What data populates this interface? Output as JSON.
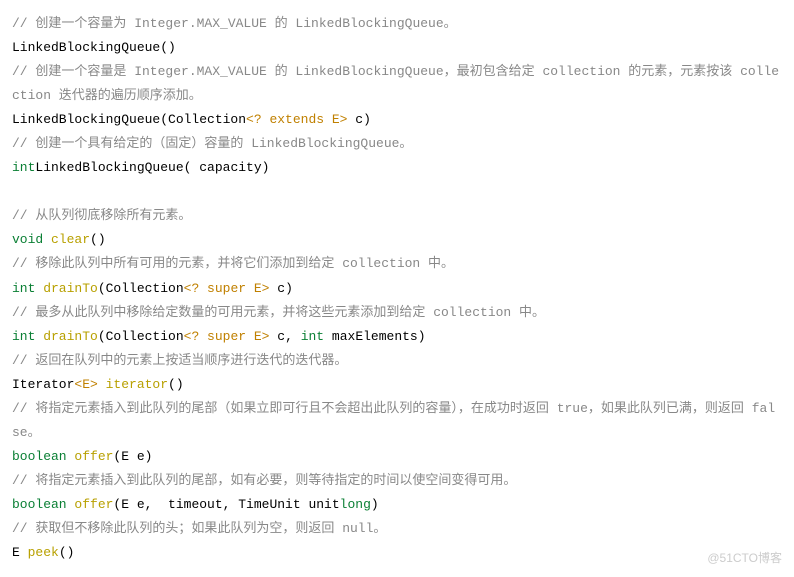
{
  "lines": [
    {
      "t": "comment",
      "v": "// 创建一个容量为 Integer.MAX_VALUE 的 LinkedBlockingQueue。"
    },
    {
      "t": "sig",
      "pre": "LinkedBlockingQueue(",
      "args": "",
      "post": ")"
    },
    {
      "t": "comment",
      "v": "// 创建一个容量是 Integer.MAX_VALUE 的 LinkedBlockingQueue，最初包含给定 collection 的元素，元素按该 collection 迭代器的遍历顺序添加。"
    },
    {
      "t": "sig",
      "pre": "LinkedBlockingQueue(Collection",
      "gen": "<? extends E>",
      "args": " c",
      "post": ")"
    },
    {
      "t": "comment",
      "v": "// 创建一个具有给定的（固定）容量的 LinkedBlockingQueue。"
    },
    {
      "t": "sig",
      "pre": "LinkedBlockingQueue(",
      "kw": "int",
      "args": " capacity",
      "post": ")"
    },
    {
      "t": "blank"
    },
    {
      "t": "comment",
      "v": "// 从队列彻底移除所有元素。"
    },
    {
      "t": "sig",
      "kw": "void",
      "name": " clear",
      "pre": "(",
      "args": "",
      "post": ")"
    },
    {
      "t": "comment",
      "v": "// 移除此队列中所有可用的元素，并将它们添加到给定 collection 中。"
    },
    {
      "t": "sig",
      "kw": "int",
      "name": " drainTo",
      "pre": "(Collection",
      "gen": "<? super E>",
      "args": " c",
      "post": ")"
    },
    {
      "t": "comment",
      "v": "// 最多从此队列中移除给定数量的可用元素，并将这些元素添加到给定 collection 中。"
    },
    {
      "t": "sig",
      "kw": "int",
      "name": " drainTo",
      "pre": "(Collection",
      "gen": "<? super E>",
      "args": " c, ",
      "kw2": "int",
      "args2": " maxElements",
      "post": ")"
    },
    {
      "t": "comment",
      "v": "// 返回在队列中的元素上按适当顺序进行迭代的迭代器。"
    },
    {
      "t": "sig",
      "pre": "Iterator",
      "gen": "<E>",
      "name": " iterator",
      "pre2": "(",
      "post": ")"
    },
    {
      "t": "comment",
      "v": "// 将指定元素插入到此队列的尾部（如果立即可行且不会超出此队列的容量），在成功时返回 true，如果此队列已满，则返回 false。"
    },
    {
      "t": "sig",
      "kw": "boolean",
      "name": " offer",
      "pre": "(E e",
      "post": ")"
    },
    {
      "t": "comment",
      "v": "// 将指定元素插入到此队列的尾部，如有必要，则等待指定的时间以使空间变得可用。"
    },
    {
      "t": "sig",
      "kw": "boolean",
      "name": " offer",
      "pre": "(E e, ",
      "kw2": "long",
      "args": " timeout, TimeUnit unit",
      "post": ")"
    },
    {
      "t": "comment",
      "v": "// 获取但不移除此队列的头；如果此队列为空，则返回 null。"
    },
    {
      "t": "sig",
      "pre": "E",
      "name": " peek",
      "pre2": "(",
      "post": ")"
    }
  ],
  "watermark": "@51CTO博客"
}
